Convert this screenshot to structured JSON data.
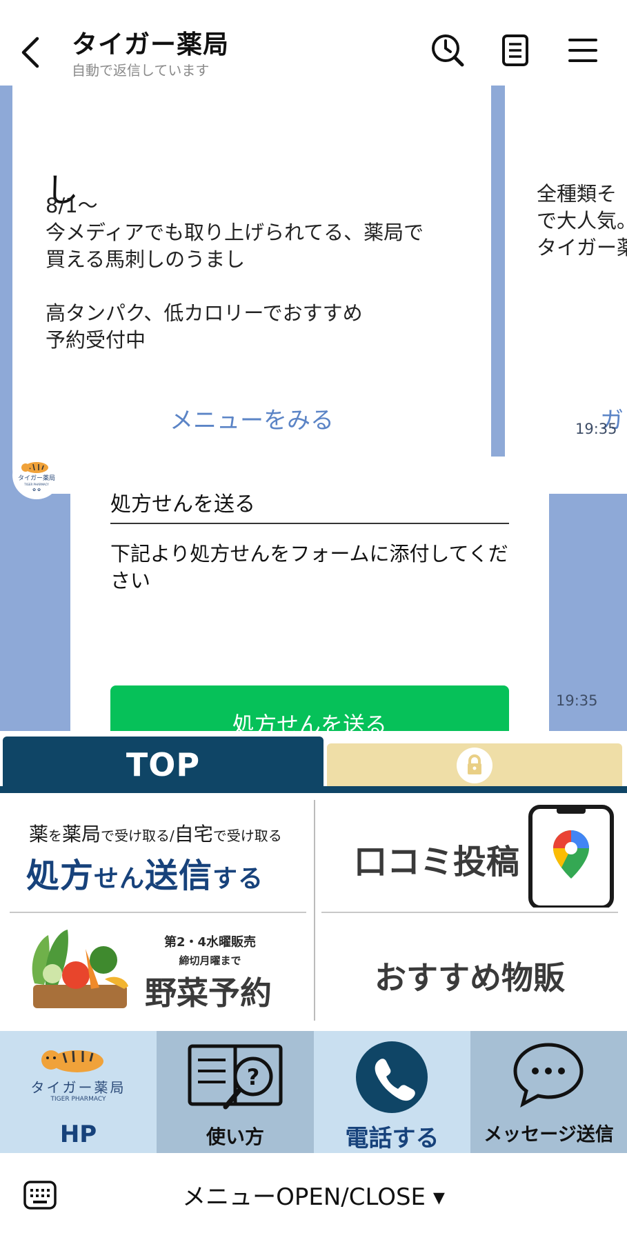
{
  "header": {
    "title": "タイガー薬局",
    "subtitle": "自動で返信しています",
    "icons": [
      "back-arrow-icon",
      "clock-search-icon",
      "notes-icon",
      "menu-icon"
    ]
  },
  "chat": {
    "card1": {
      "big_char": "し",
      "body": "8/1～\n今メディアでも取り上げられてる、薬局で\n買える馬刺しのうまし\n\n高タンパク、低カロリーでおすすめ\n予約受付中",
      "link": "メニューをみる"
    },
    "card2": {
      "body": "全種類そ\nで大人気。\nタイガー薬",
      "link": "ガ"
    },
    "time1": "19:35",
    "avatar": {
      "name": "タイガー薬局",
      "sub": "TIGER PHARMACY"
    },
    "bubble": {
      "title": "処方せんを送る",
      "text": "下記より処方せんをフォームに添付してください",
      "button": "処方せんを送る",
      "time": "19:35"
    }
  },
  "richmenu": {
    "tab_top": "TOP",
    "rx": {
      "line1": [
        "薬",
        "を",
        "薬局",
        "で受け取る/",
        "自宅",
        "で受け取る"
      ],
      "line2": [
        "処方",
        "せん",
        "送信",
        "する"
      ]
    },
    "review": "口コミ投稿",
    "veg": {
      "line1": "第2・4水曜販売",
      "line2": "締切月曜まで",
      "big": "野菜予約"
    },
    "goods": "おすすめ物販",
    "bottom": {
      "hp": {
        "logo": "タイガー薬局",
        "logo_sub": "TIGER PHARMACY",
        "label": "HP"
      },
      "howto": "使い方",
      "call": "電話する",
      "message": "メッセージ送信"
    },
    "colors": {
      "navy": "#0f4566",
      "green": "#06c159",
      "chat_bg": "#8ea9d7",
      "cell_light": "#c9dff0",
      "cell_dark": "#a6bfd4"
    }
  },
  "footer": {
    "menu_toggle": "メニューOPEN/CLOSE ▾",
    "icon": "keyboard-icon"
  }
}
